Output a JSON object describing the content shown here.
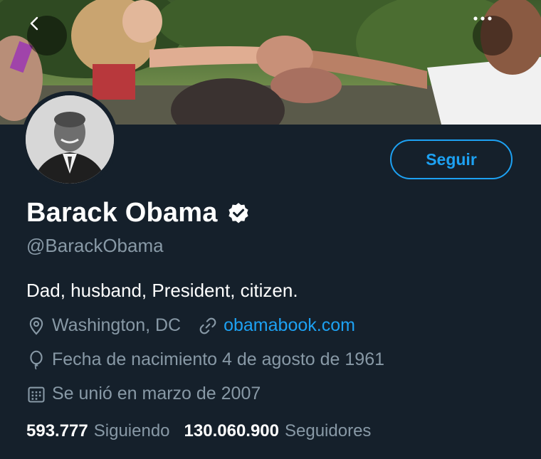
{
  "profile": {
    "name": "Barack Obama",
    "handle": "@BarackObama",
    "bio": "Dad, husband, President, citizen.",
    "location": "Washington, DC",
    "website": "obamabook.com",
    "birthday": "Fecha de nacimiento 4 de agosto de 1961",
    "joined": "Se unió en marzo de 2007",
    "verified": true
  },
  "actions": {
    "follow_label": "Seguir"
  },
  "stats": {
    "following_count": "593.777",
    "following_label": "Siguiendo",
    "followers_count": "130.060.900",
    "followers_label": "Seguidores"
  },
  "colors": {
    "background": "#15202b",
    "accent": "#1da1f2",
    "secondary_text": "#8899a6"
  },
  "icons": [
    "back-arrow-icon",
    "more-options-icon",
    "verified-badge-icon",
    "location-pin-icon",
    "link-icon",
    "balloon-icon",
    "calendar-icon"
  ]
}
